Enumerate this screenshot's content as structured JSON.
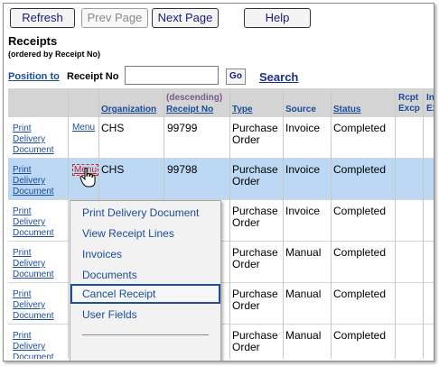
{
  "toolbar": {
    "refresh": "Refresh",
    "prev_page": "Prev Page",
    "next_page": "Next Page",
    "help": "Help"
  },
  "page": {
    "title": "Receipts",
    "subtitle": "(ordered by Receipt No)"
  },
  "position": {
    "link": "Position to",
    "label": "Receipt No",
    "input_value": "",
    "go": "Go",
    "search": "Search"
  },
  "table": {
    "headers": {
      "organization": "Organization",
      "descending": "(descending)",
      "receipt_no": "Receipt No",
      "type": "Type",
      "source": "Source",
      "status": "Status",
      "rcpt_excp_1": "Rcpt",
      "rcpt_excp_2": "Excp",
      "inv_excp_1": "Inv",
      "inv_excp_2": "Exc"
    },
    "print_link": [
      "Print",
      "Delivery",
      "Document"
    ],
    "menu_label": "Menu",
    "rows": [
      {
        "organization": "CHS",
        "receipt_no": "99799",
        "type": [
          "Purchase",
          "Order"
        ],
        "source": "Invoice",
        "status": "Completed"
      },
      {
        "organization": "CHS",
        "receipt_no": "99798",
        "type": [
          "Purchase",
          "Order"
        ],
        "source": "Invoice",
        "status": "Completed"
      },
      {
        "organization": "",
        "receipt_no": "",
        "type": [
          "Purchase",
          "Order"
        ],
        "source": "Invoice",
        "status": "Completed"
      },
      {
        "organization": "",
        "receipt_no": "",
        "type": [
          "Purchase",
          "Order"
        ],
        "source": "Manual",
        "status": "Completed"
      },
      {
        "organization": "",
        "receipt_no": "",
        "type": [
          "Purchase",
          "Order"
        ],
        "source": "Manual",
        "status": "Completed"
      },
      {
        "organization": "",
        "receipt_no": "",
        "type": [
          "Purchase",
          "Order"
        ],
        "source": "Manual",
        "status": "Completed"
      }
    ]
  },
  "popup": {
    "items": [
      "Print Delivery Document",
      "View Receipt Lines",
      "Invoices",
      "Documents",
      "Cancel Receipt",
      "User Fields"
    ],
    "highlighted": "Cancel Receipt"
  },
  "colors": {
    "link": "#1a4c9a",
    "selected_row": "#bcd8f4",
    "header_bg": "#d4d4d4"
  }
}
